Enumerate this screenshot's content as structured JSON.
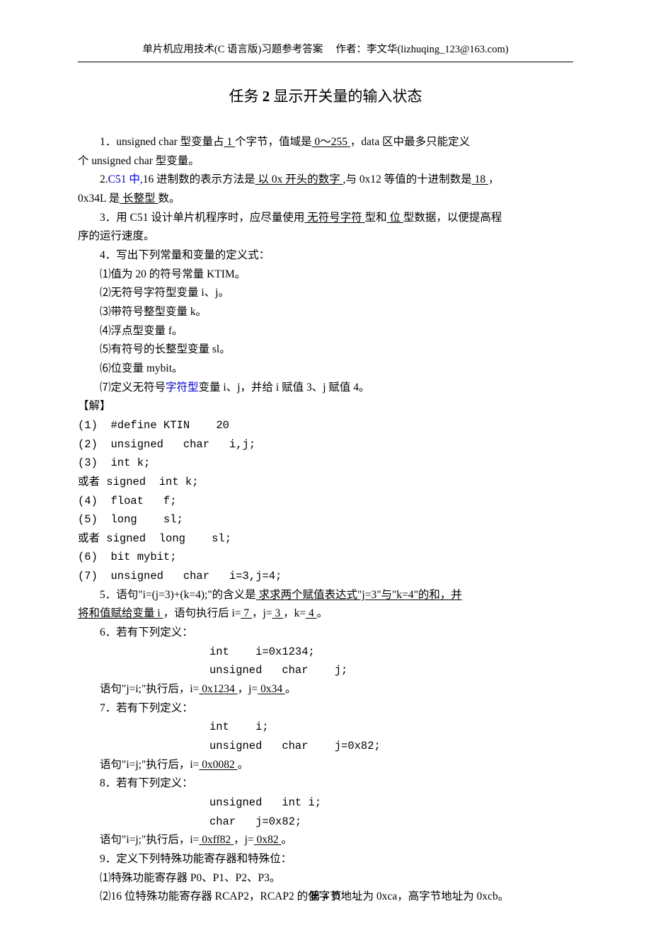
{
  "header": {
    "left": "单片机应用技术(C 语言版)习题参考答案",
    "right": "作者：李文华(lizhuqing_123@163.com)"
  },
  "title": {
    "pre": "任务 ",
    "num": "2",
    "post": " 显示开关量的输入状态"
  },
  "q1": {
    "t1": "1．unsigned char 型变量占",
    "a1": " 1 ",
    "t2": "个字节，值域是",
    "a2": " 0～255 ",
    "t3": "，data 区中最多只能定义",
    "t4": "个 unsigned char 型变量。"
  },
  "q2": {
    "t0": "2.",
    "blue": "C51 中,",
    "t1": "16 进制数的表示方法是",
    "a1": " 以 0x 开头的数字 ",
    "t2": ",与 0x12 等值的十进制数是",
    "a2": " 18 ",
    "t3": "，",
    "t4": "0x34L 是",
    "a3": " 长整型 ",
    "t5": "数。"
  },
  "q3": {
    "t1": "3．用 C51 设计单片机程序时，应尽量使用",
    "a1": " 无符号字符 ",
    "t2": "型和",
    "a2": " 位 ",
    "t3": "型数据，以便提高程",
    "t4": "序的运行速度。"
  },
  "q4": {
    "head": "4．写出下列常量和变量的定义式：",
    "items": [
      "⑴值为 20 的符号常量 KTIM。",
      "⑵无符号字符型变量 i、j。",
      "⑶带符号整型变量 k。",
      "⑷浮点型变量 f。",
      "⑸有符号的长整型变量 sl。",
      "⑹位变量 mybit。"
    ],
    "item7a": "⑺定义无符号",
    "item7blue": "字符型",
    "item7b": "变量 i、j，并给 i 赋值 3、j 赋值 4。"
  },
  "solMark": "【解】",
  "sol": [
    "(1)  #define KTIN    20",
    "(2)  unsigned   char   i,j;",
    "(3)  int k;",
    "或者 signed  int k;",
    "(4)  float   f;",
    "(5)  long    sl;",
    "或者 signed  long    sl;",
    "(6)  bit mybit;",
    "(7)  unsigned   char   i=3,j=4;"
  ],
  "q5": {
    "t1": "5．语句\"i=(j=3)+(k=4);\"的含义是",
    "a1": " 求求两个赋值表达式\"j=3\"与\"k=4\"的和，并",
    "a1b": "将和值赋给变量 i ",
    "t2": "，语句执行后 i=",
    "a2": " 7 ",
    "t3": "，j=",
    "a3": " 3 ",
    "t4": "，k=",
    "a4": " 4 ",
    "t5": "。"
  },
  "q6": {
    "head": "6．若有下列定义：",
    "c1": "int    i=0x1234;",
    "c2": "unsigned   char    j;",
    "t1": "语句\"j=i;\"执行后，i=",
    "a1": " 0x1234 ",
    "t2": "，j=",
    "a2": " 0x34 ",
    "t3": "。"
  },
  "q7": {
    "head": "7．若有下列定义：",
    "c1": "int    i;",
    "c2": "unsigned   char    j=0x82;",
    "t1": "语句\"i=j;\"执行后，i=",
    "a1": " 0x0082 ",
    "t2": "。"
  },
  "q8": {
    "head": "8．若有下列定义：",
    "c1": "unsigned   int i;",
    "c2": "char   j=0x82;",
    "t1": "语句\"i=j;\"执行后，i=",
    "a1": " 0xff82 ",
    "t2": "，j=",
    "a2": " 0x82 ",
    "t3": "。"
  },
  "q9": {
    "head": "9．定义下列特殊功能寄存器和特殊位：",
    "i1": "⑴特殊功能寄存器 P0、P1、P2、P3。",
    "i2": "⑵16 位特殊功能寄存器 RCAP2，RCAP2 的低字节地址为 0xca，高字节地址为 0xcb。"
  },
  "footer": "第 4 页"
}
